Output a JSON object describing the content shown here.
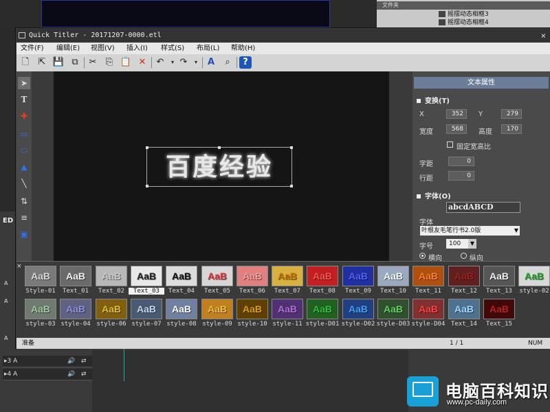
{
  "host": {
    "library_header": "文件夹",
    "library_items": [
      "摇摆动态相框3",
      "摇摆动态相框4"
    ],
    "edit_label": "ED",
    "tracks": [
      {
        "name": "▸3 A"
      },
      {
        "name": "▸4 A"
      }
    ],
    "track_badges": [
      "A",
      "A",
      "A",
      "A",
      "A"
    ]
  },
  "window": {
    "title": "Quick Titler - 20171207-0000.etl",
    "close_glyph": "×"
  },
  "menu": [
    "文件(F)",
    "编辑(E)",
    "视图(V)",
    "插入(I)",
    "样式(S)",
    "布局(L)",
    "帮助(H)"
  ],
  "toolbar": {
    "icons": [
      "new-icon",
      "open-icon",
      "save-icon",
      "save-as-icon",
      "cut-icon",
      "copy-icon",
      "paste-icon",
      "delete-icon",
      "undo-icon",
      "redo-icon",
      "text-style-icon",
      "find-icon",
      "help-icon"
    ],
    "glyphs": [
      "🗋",
      "⇱",
      "💾",
      "⧉",
      "✂",
      "⎘",
      "📋",
      "✕",
      "↶",
      "↷",
      "A",
      "⌕",
      "?"
    ]
  },
  "tools": {
    "icons": [
      "select-arrow-icon",
      "text-tool-icon",
      "crosshair-icon",
      "rectangle-icon",
      "ellipse-icon",
      "triangle-icon",
      "line-icon",
      "align-icon",
      "distribute-icon",
      "layer-icon"
    ],
    "glyphs": [
      "➤",
      "T",
      "✚",
      "▭",
      "⬭",
      "▲",
      "╲",
      "⇅",
      "≡",
      "▣"
    ]
  },
  "canvas": {
    "text": "百度经验"
  },
  "properties": {
    "header": "文本属性",
    "transform_title": "变换(T)",
    "x_label": "X",
    "x_value": "352",
    "y_label": "Y",
    "y_value": "279",
    "width_label": "宽度",
    "width_value": "568",
    "height_label": "高度",
    "height_value": "170",
    "fixed_ratio_label": "固定宽高比",
    "char_spacing_label": "字距",
    "char_spacing_value": "0",
    "line_spacing_label": "行距",
    "line_spacing_value": "0",
    "font_title": "字体(O)",
    "font_sample": "abcdABCD",
    "font_label": "字体",
    "font_value": "叶根友毛笔行书2.0版",
    "size_label": "字号",
    "size_value": "100",
    "horizontal_label": "横向",
    "vertical_label": "纵向"
  },
  "styles": [
    {
      "label": "Style-01",
      "text": "AaB",
      "color": "#d8d8d8",
      "bg": "#7a7a7a"
    },
    {
      "label": "Text_01",
      "text": "AaB",
      "color": "#f2f2f2",
      "bg": "#6a6a6a"
    },
    {
      "label": "Text_02",
      "text": "AaB",
      "color": "#c8c8c8",
      "bg": "#b8b8b8"
    },
    {
      "label": "Text_03",
      "text": "AaB",
      "color": "#222222",
      "bg": "#e8e8e8"
    },
    {
      "label": "Text_04",
      "text": "AaB",
      "color": "#111111",
      "bg": "#dcdcdc"
    },
    {
      "label": "Text_05",
      "text": "AaB",
      "color": "#e03030",
      "bg": "#d6d6d6"
    },
    {
      "label": "Text_06",
      "text": "AaB",
      "color": "#f0a0a0",
      "bg": "#e08080"
    },
    {
      "label": "Text_07",
      "text": "AaB",
      "color": "#c07000",
      "bg": "#d8b040"
    },
    {
      "label": "Text_08",
      "text": "AaB",
      "color": "#ff5050",
      "bg": "#c02020"
    },
    {
      "label": "Text_09",
      "text": "AaB",
      "color": "#5060ff",
      "bg": "#2030a0"
    },
    {
      "label": "Text_10",
      "text": "AaB",
      "color": "#f8f8f8",
      "bg": "#9aa8c0"
    },
    {
      "label": "Text_11",
      "text": "AaB",
      "color": "#ff8020",
      "bg": "#b05010"
    },
    {
      "label": "Text_12",
      "text": "AaB",
      "color": "#a02020",
      "bg": "#602020"
    },
    {
      "label": "Text_13",
      "text": "AaB",
      "color": "#f0f0f0",
      "bg": "#555555"
    },
    {
      "label": "style-02",
      "text": "AaB",
      "color": "#20a020",
      "bg": "#d8d8d8"
    },
    {
      "label": "style-03",
      "text": "AaB",
      "color": "#a0c8a0",
      "bg": "#707a70"
    },
    {
      "label": "style-04",
      "text": "AaB",
      "color": "#9090e0",
      "bg": "#606080"
    },
    {
      "label": "style-06",
      "text": "AaB",
      "color": "#e0c020",
      "bg": "#806010"
    },
    {
      "label": "style-07",
      "text": "AaB",
      "color": "#c0d8f0",
      "bg": "#4a5a70"
    },
    {
      "label": "style-08",
      "text": "AaB",
      "color": "#ffffff",
      "bg": "#7080a0"
    },
    {
      "label": "style-09",
      "text": "AaB",
      "color": "#f0c040",
      "bg": "#c08020"
    },
    {
      "label": "style-10",
      "text": "AaB",
      "color": "#e0a000",
      "bg": "#604000"
    },
    {
      "label": "style-11",
      "text": "AaB",
      "color": "#b070e0",
      "bg": "#503070"
    },
    {
      "label": "style-D01",
      "text": "AaB",
      "color": "#30c040",
      "bg": "#206020"
    },
    {
      "label": "style-D02",
      "text": "AaB",
      "color": "#40a0ff",
      "bg": "#204080"
    },
    {
      "label": "style-D03",
      "text": "AaB",
      "color": "#60d060",
      "bg": "#305030"
    },
    {
      "label": "style-D04",
      "text": "AaB",
      "color": "#ff4040",
      "bg": "#803030"
    },
    {
      "label": "Text_14",
      "text": "AaB",
      "color": "#a0d8ff",
      "bg": "#507090"
    },
    {
      "label": "Text_15",
      "text": "AaB",
      "color": "#c02020",
      "bg": "#400808"
    }
  ],
  "selected_style": "Text_03",
  "status": {
    "left": "准备",
    "page": "1 / 1",
    "mode": "NUM"
  },
  "watermark": {
    "text": "电脑百科知识",
    "url": "www.pc-daily.com"
  }
}
